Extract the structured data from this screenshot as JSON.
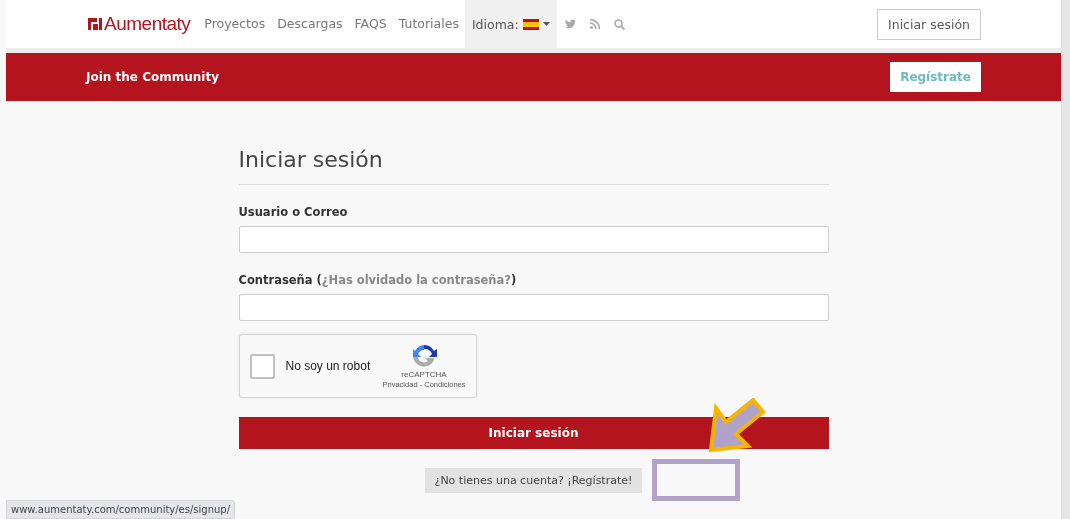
{
  "navbar": {
    "logo": "Aumentaty",
    "links": [
      "Proyectos",
      "Descargas",
      "FAQS",
      "Tutoriales"
    ],
    "language": {
      "label": "Idioma:",
      "expanded": false
    },
    "login_button": "Iniciar sesión"
  },
  "banner": {
    "title": "Join the Community",
    "button": "Regístrate"
  },
  "form": {
    "title": "Iniciar sesión",
    "fields": [
      {
        "label": "Usuario o Correo"
      },
      {
        "label": "Contraseña",
        "link_open": "(",
        "link": "¿Has olvidado la contraseña?",
        "link_close": ")"
      }
    ],
    "captcha": {
      "label": "No soy un robot",
      "checked": false,
      "brand": "reCAPTCHA",
      "terms": "Privacidad - Condiciones"
    },
    "submit": "Iniciar sesión",
    "signup_prompt": "¿No tienes una cuenta? ¡Regístrate!"
  },
  "status_url": "www.aumentaty.com/community/es/signup/"
}
